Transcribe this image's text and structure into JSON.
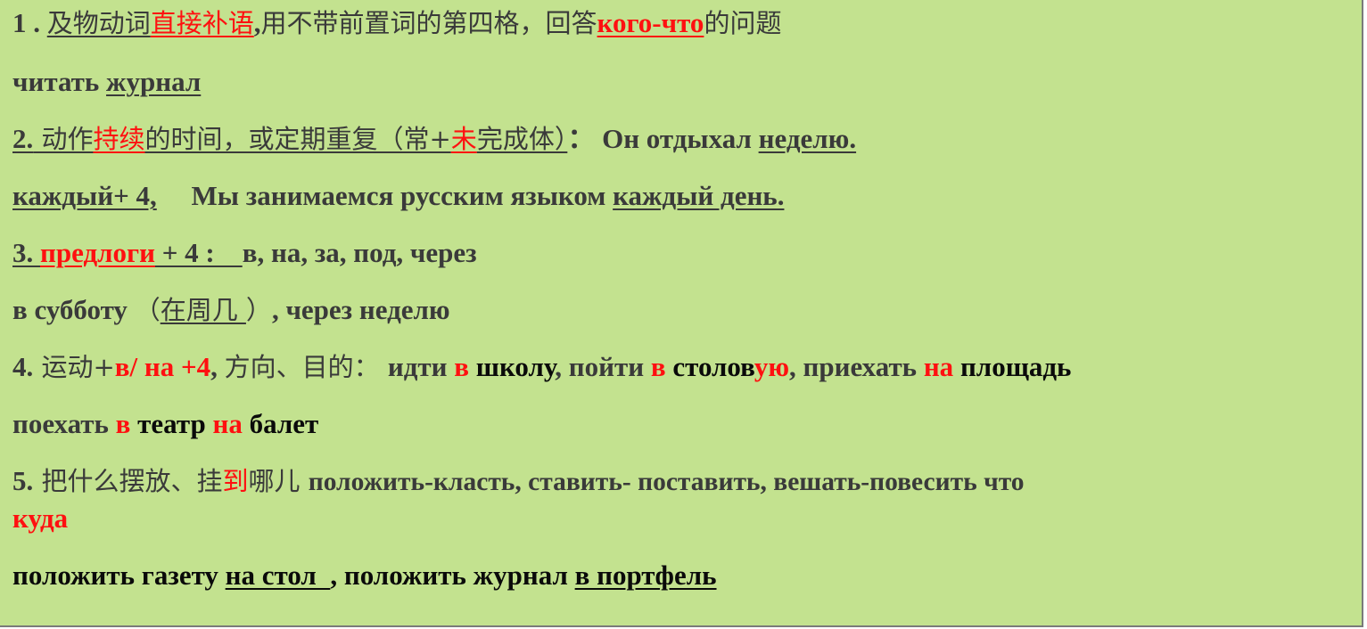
{
  "l1": {
    "num": "1 . ",
    "a": "及物动词",
    "b": "直接补语",
    "c": ",",
    "d": "用不带前置词的第四格，回答",
    "e": "кого-что",
    "f": "的问题"
  },
  "l2": {
    "a": "читать ",
    "b": "журнал"
  },
  "l3": {
    "a": "2.",
    "b": " 动作",
    "c": "持续",
    "d": "的时间，或定期重复（常+",
    "e": "未",
    "f": "完成体）",
    "g": "：  Он отдыхал ",
    "h": "неделю."
  },
  "l4": {
    "a": "каждый+ 4,",
    "b": "     Мы занимаемся русским языком ",
    "c": "каждый день."
  },
  "l5": {
    "a": "3. ",
    "b": "предлоги",
    "c": " + 4 :    ",
    "d": "в, на, за, под, через"
  },
  "l6": {
    "a": "в субботу ",
    "b": "（",
    "c": "在周几 ",
    "d": "）",
    "e": ", через неделю"
  },
  "l7": {
    "a": "4.",
    "b": " 运动+",
    "c": "в/ на +4",
    "d": ", ",
    "e": "方向、目的：  ",
    "f": "идти ",
    "g": "в",
    "h": " школу",
    "i": ", пойти ",
    "j": "в",
    "k": " столов",
    "l": "ую",
    "m": ", приехать ",
    "n": "на",
    "o": " площадь"
  },
  "l8": {
    "a": " поехать ",
    "b": "в",
    "c": " театр ",
    "d": "на",
    "e": " балет"
  },
  "l9": {
    "a": "5.",
    "b": " 把什么摆放、挂",
    "c": "到",
    "d": "哪儿  ",
    "e": "положить-класть, ставить- поставить, вешать-повесить  что"
  },
  "l10": {
    "a": "куда"
  },
  "l11": {
    "a": "положить газету ",
    "b": "на стол  ",
    "c": ", положить журнал ",
    "d": "в портфель"
  }
}
